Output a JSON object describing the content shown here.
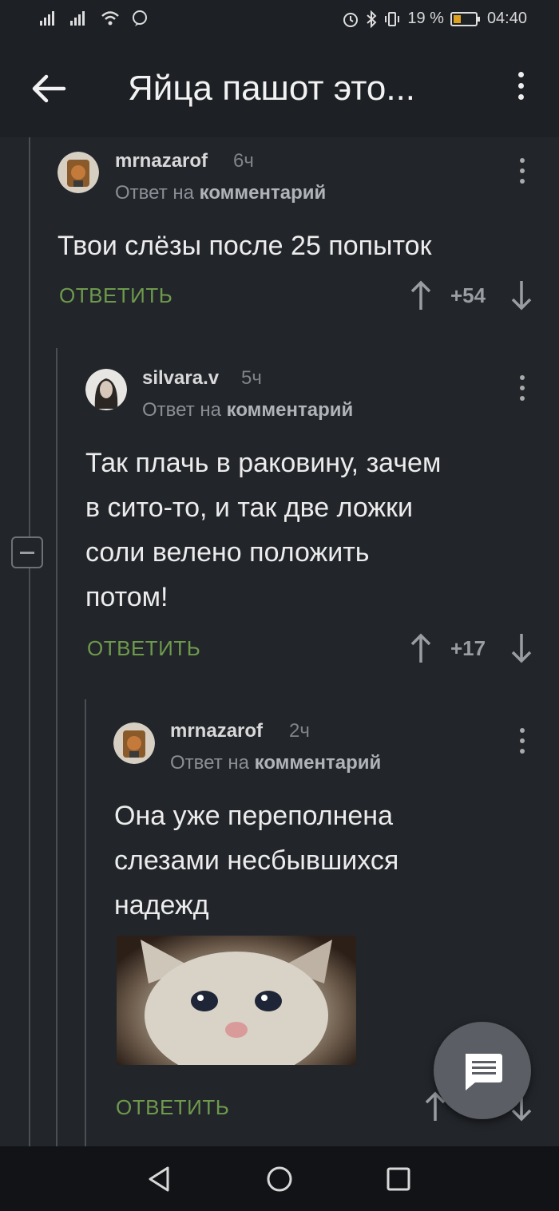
{
  "status": {
    "battery": "19 %",
    "time": "04:40"
  },
  "header": {
    "title": "Яйца пашот это..."
  },
  "comments": [
    {
      "author": "mrnazarof",
      "time": "6ч",
      "reply_prefix": "Ответ на",
      "reply_target": "комментарий",
      "lines": [
        "Твои слёзы после 25 попыток"
      ],
      "reply_label": "ОТВЕТИТЬ",
      "score": "+54"
    },
    {
      "author": "silvara.v",
      "time": "5ч",
      "reply_prefix": "Ответ на",
      "reply_target": "комментарий",
      "lines": [
        "Так плачь в раковину, зачем",
        "в сито-то, и так две ложки",
        "соли велено положить",
        "потом!"
      ],
      "reply_label": "ОТВЕТИТЬ",
      "score": "+17"
    },
    {
      "author": "mrnazarof",
      "time": "2ч",
      "reply_prefix": "Ответ на",
      "reply_target": "комментарий",
      "lines": [
        "Она уже переполнена",
        "слезами несбывшихся",
        "надежд"
      ],
      "reply_label": "ОТВЕТИТЬ"
    }
  ],
  "colors": {
    "background": "#22252a",
    "accent_green": "#6d9a4c",
    "fab": "#5b5f65"
  }
}
